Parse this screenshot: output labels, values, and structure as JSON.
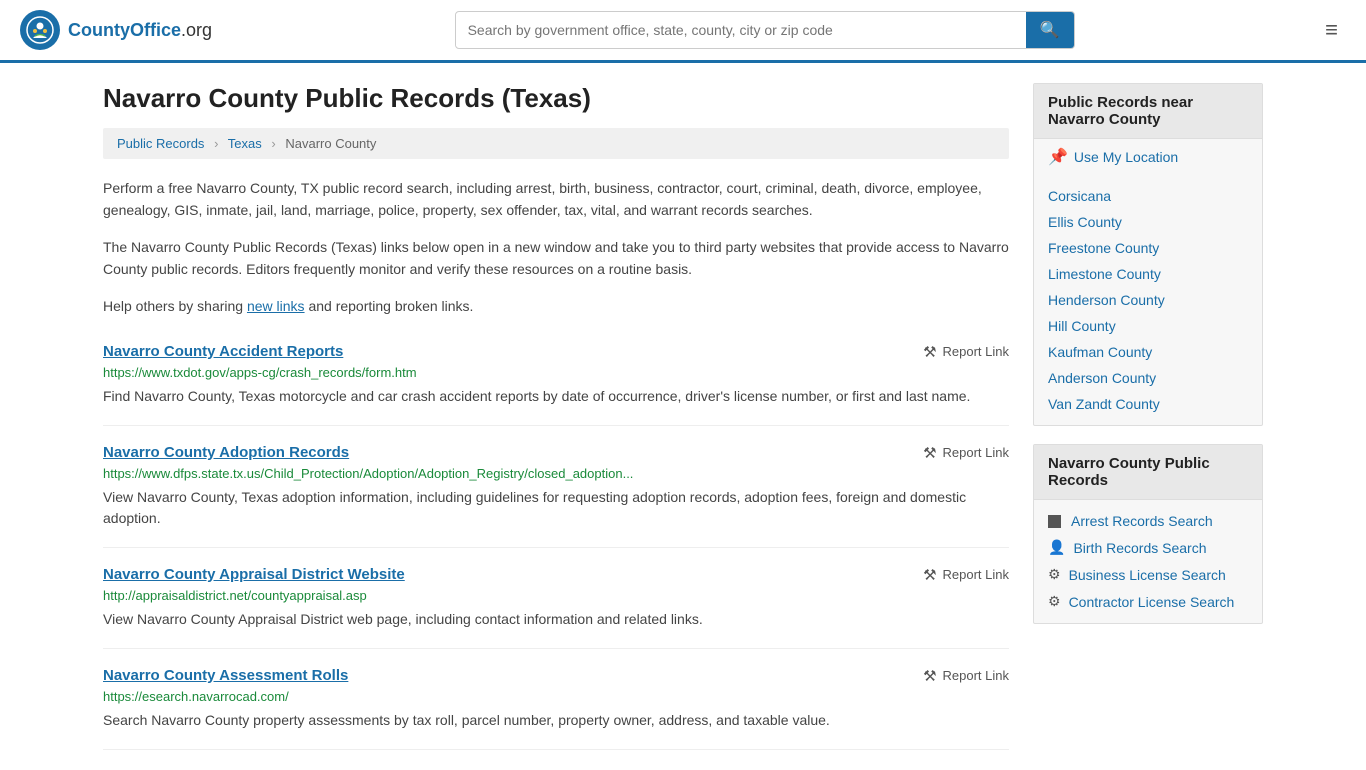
{
  "header": {
    "logo_letter": "C",
    "logo_brand": "CountyOffice",
    "logo_org": ".org",
    "search_placeholder": "Search by government office, state, county, city or zip code",
    "search_button_label": "🔍",
    "menu_icon": "≡"
  },
  "page": {
    "title": "Navarro County Public Records (Texas)",
    "breadcrumb": {
      "items": [
        "Public Records",
        "Texas",
        "Navarro County"
      ],
      "separators": [
        "›",
        "›"
      ]
    },
    "intro1": "Perform a free Navarro County, TX public record search, including arrest, birth, business, contractor, court, criminal, death, divorce, employee, genealogy, GIS, inmate, jail, land, marriage, police, property, sex offender, tax, vital, and warrant records searches.",
    "intro2": "The Navarro County Public Records (Texas) links below open in a new window and take you to third party websites that provide access to Navarro County public records. Editors frequently monitor and verify these resources on a routine basis.",
    "intro3_prefix": "Help others by sharing ",
    "intro3_link": "new links",
    "intro3_suffix": " and reporting broken links.",
    "records": [
      {
        "title": "Navarro County Accident Reports",
        "url": "https://www.txdot.gov/apps-cg/crash_records/form.htm",
        "desc": "Find Navarro County, Texas motorcycle and car crash accident reports by date of occurrence, driver's license number, or first and last name.",
        "report_label": "Report Link"
      },
      {
        "title": "Navarro County Adoption Records",
        "url": "https://www.dfps.state.tx.us/Child_Protection/Adoption/Adoption_Registry/closed_adoption...",
        "desc": "View Navarro County, Texas adoption information, including guidelines for requesting adoption records, adoption fees, foreign and domestic adoption.",
        "report_label": "Report Link"
      },
      {
        "title": "Navarro County Appraisal District Website",
        "url": "http://appraisaldistrict.net/countyappraisal.asp",
        "desc": "View Navarro County Appraisal District web page, including contact information and related links.",
        "report_label": "Report Link"
      },
      {
        "title": "Navarro County Assessment Rolls",
        "url": "https://esearch.navarrocad.com/",
        "desc": "Search Navarro County property assessments by tax roll, parcel number, property owner, address, and taxable value.",
        "report_label": "Report Link"
      }
    ]
  },
  "sidebar": {
    "nearby_title": "Public Records near Navarro County",
    "use_location": "Use My Location",
    "nearby_links": [
      "Corsicana",
      "Ellis County",
      "Freestone County",
      "Limestone County",
      "Henderson County",
      "Hill County",
      "Kaufman County",
      "Anderson County",
      "Van Zandt County"
    ],
    "navarro_records_title": "Navarro County Public Records",
    "navarro_records_links": [
      {
        "label": "Arrest Records Search",
        "icon": "square"
      },
      {
        "label": "Birth Records Search",
        "icon": "person"
      },
      {
        "label": "Business License Search",
        "icon": "gear"
      },
      {
        "label": "Contractor License Search",
        "icon": "gear"
      }
    ]
  }
}
